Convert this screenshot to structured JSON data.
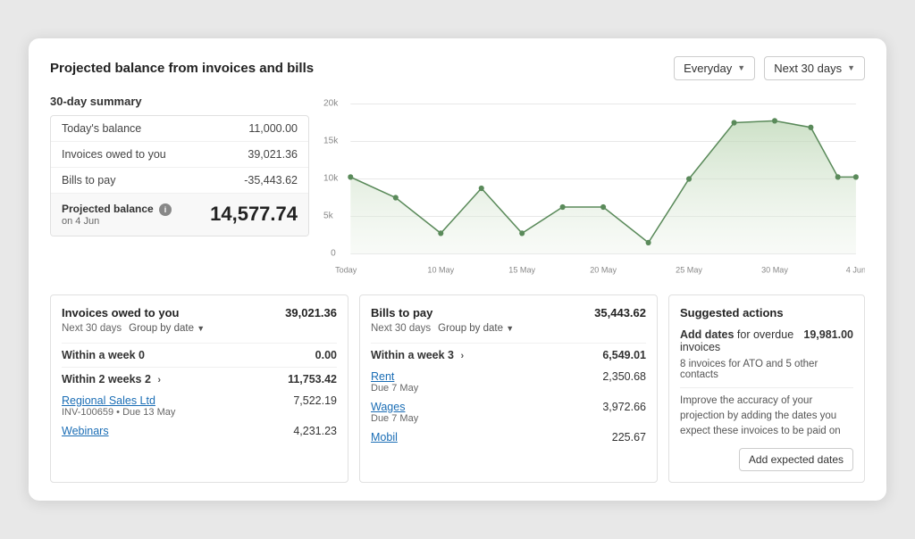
{
  "header": {
    "title": "Projected balance from invoices and bills",
    "dropdown1": "Everyday",
    "dropdown2": "Next 30 days"
  },
  "summary": {
    "label": "30-day summary",
    "rows": [
      {
        "label": "Today's balance",
        "value": "11,000.00"
      },
      {
        "label": "Invoices owed to you",
        "value": "39,021.36"
      },
      {
        "label": "Bills to pay",
        "value": "-35,443.62"
      }
    ],
    "projected_label": "Projected balance",
    "projected_sub": "on 4 Jun",
    "projected_value": "14,577.74"
  },
  "chart": {
    "y_labels": [
      "20k",
      "15k",
      "10k",
      "5k",
      "0"
    ],
    "x_labels": [
      "Today",
      "10 May",
      "15 May",
      "20 May",
      "25 May",
      "30 May",
      "4 Jun"
    ]
  },
  "invoices_panel": {
    "title": "Invoices owed to you",
    "amount": "39,021.36",
    "sub_period": "Next 30 days",
    "sub_group": "Group by date",
    "sections": [
      {
        "label": "Within a week 0",
        "value": "0.00",
        "items": []
      },
      {
        "label": "Within 2 weeks 2",
        "value": "11,753.42",
        "has_chevron": true,
        "items": [
          {
            "link": "Regional Sales Ltd",
            "sub": "INV-100659 • Due 13 May",
            "value": "7,522.19"
          },
          {
            "link": "Webinars",
            "sub": "",
            "value": "4,231.23"
          }
        ]
      }
    ]
  },
  "bills_panel": {
    "title": "Bills to pay",
    "amount": "35,443.62",
    "sub_period": "Next 30 days",
    "sub_group": "Group by date",
    "sections": [
      {
        "label": "Within a week 3",
        "value": "6,549.01",
        "has_chevron": true,
        "items": [
          {
            "link": "Rent",
            "sub": "Due 7 May",
            "value": "2,350.68"
          },
          {
            "link": "Wages",
            "sub": "Due 7 May",
            "value": "3,972.66"
          },
          {
            "link": "Mobil",
            "sub": "",
            "value": "225.67"
          }
        ]
      }
    ]
  },
  "suggested": {
    "title": "Suggested actions",
    "action_label_pre": "Add dates",
    "action_label_post": "for overdue invoices",
    "action_amount": "19,981.00",
    "action_desc": "8 invoices for ATO and 5 other contacts",
    "action_body": "Improve the accuracy of your projection by adding the dates you expect these invoices to be paid on",
    "button_label": "Add expected dates"
  }
}
